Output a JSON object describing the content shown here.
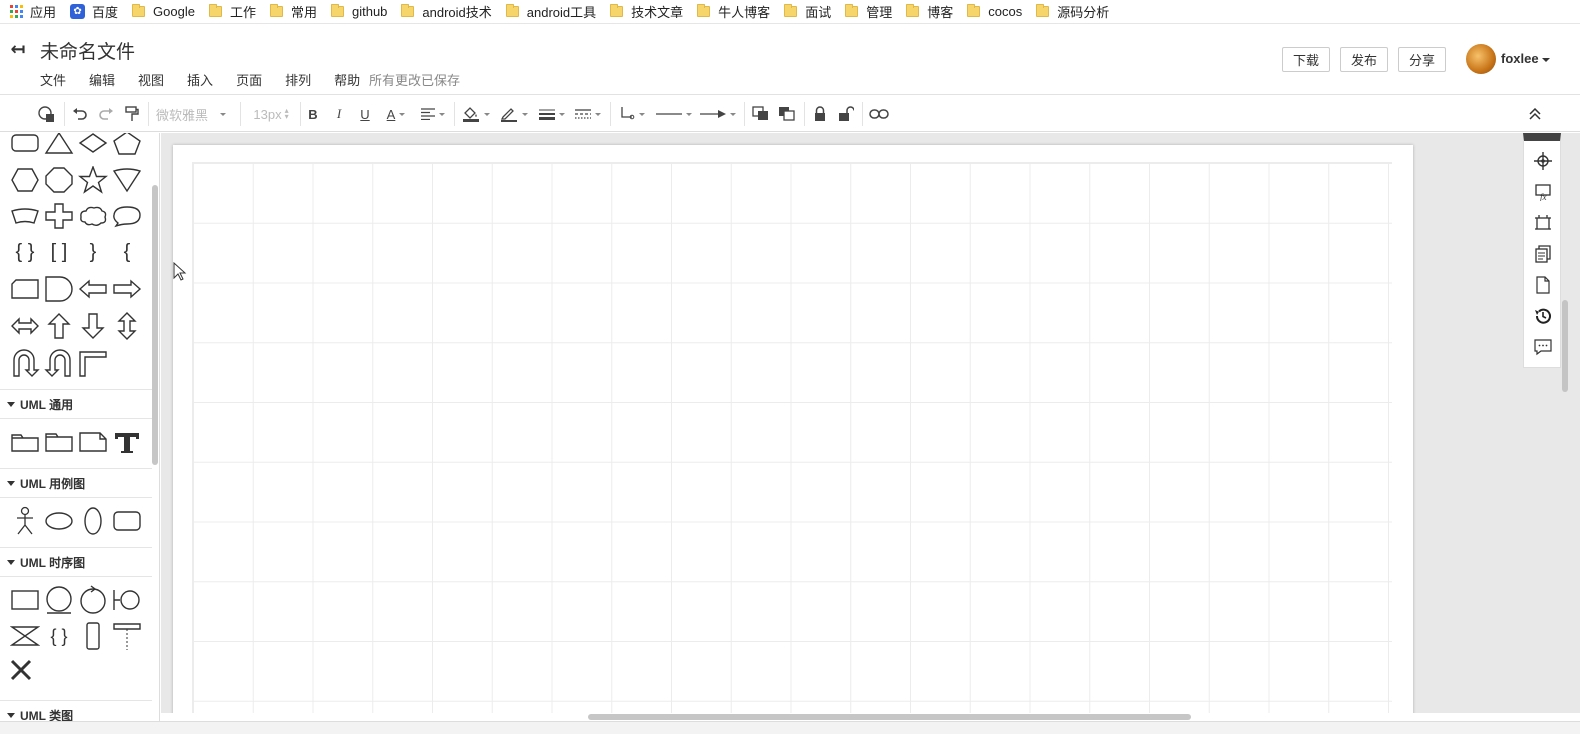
{
  "bookmarks": [
    {
      "label": "应用",
      "icon": "apps-icon"
    },
    {
      "label": "百度",
      "icon": "baidu-paw-icon"
    },
    {
      "label": "Google",
      "icon": "folder-icon"
    },
    {
      "label": "工作",
      "icon": "folder-icon"
    },
    {
      "label": "常用",
      "icon": "folder-icon"
    },
    {
      "label": "github",
      "icon": "folder-icon"
    },
    {
      "label": "android技术",
      "icon": "folder-icon"
    },
    {
      "label": "android工具",
      "icon": "folder-icon"
    },
    {
      "label": "技术文章",
      "icon": "folder-icon"
    },
    {
      "label": "牛人博客",
      "icon": "folder-icon"
    },
    {
      "label": "面试",
      "icon": "folder-icon"
    },
    {
      "label": "管理",
      "icon": "folder-icon"
    },
    {
      "label": "博客",
      "icon": "folder-icon"
    },
    {
      "label": "cocos",
      "icon": "folder-icon"
    },
    {
      "label": "源码分析",
      "icon": "folder-icon"
    }
  ],
  "header": {
    "title": "未命名文件",
    "menu": [
      "文件",
      "编辑",
      "视图",
      "插入",
      "页面",
      "排列",
      "帮助"
    ],
    "save_status": "所有更改已保存",
    "download": "下载",
    "publish": "发布",
    "share": "分享",
    "username": "foxlee"
  },
  "toolbar": {
    "font_family": "微软雅黑",
    "font_size": "13px",
    "bold": "B",
    "italic": "I",
    "underline": "U",
    "font_color": "A"
  },
  "sidebar": {
    "categories": [
      "UML 通用",
      "UML 用例图",
      "UML 时序图",
      "UML 类图"
    ]
  },
  "colors": {
    "folder": "#f6d56b",
    "canvas_bg": "#e8e8e8",
    "grid_line": "#ececec"
  }
}
